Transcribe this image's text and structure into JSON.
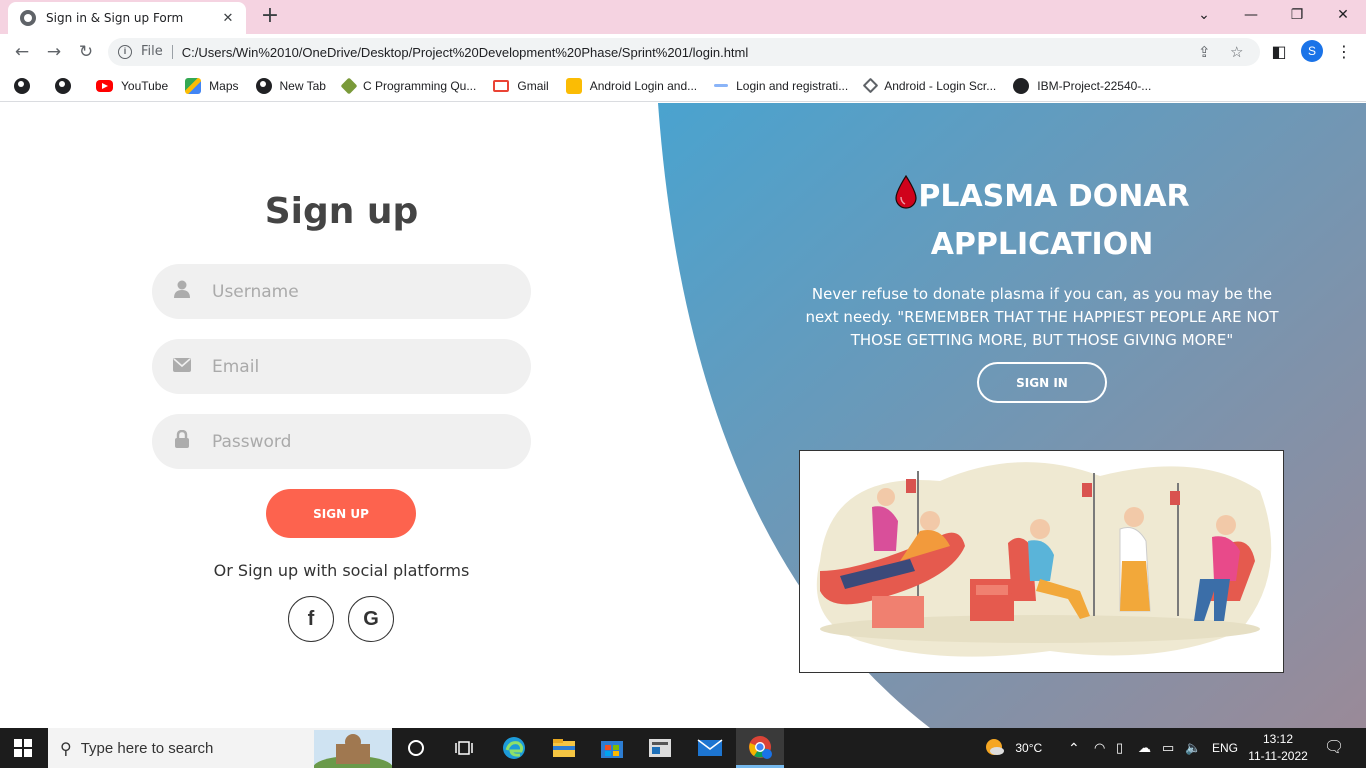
{
  "browser": {
    "tab_title": "Sign in & Sign up Form",
    "tab_close": "✕",
    "new_tab": "+",
    "scheme": "File",
    "url": "C:/Users/Win%2010/OneDrive/Desktop/Project%20Development%20Phase/Sprint%201/login.html",
    "profile_initial": "S",
    "bookmarks": [
      {
        "label": ""
      },
      {
        "label": ""
      },
      {
        "label": "YouTube"
      },
      {
        "label": "Maps"
      },
      {
        "label": "New Tab"
      },
      {
        "label": "C Programming Qu..."
      },
      {
        "label": "Gmail"
      },
      {
        "label": "Android Login and..."
      },
      {
        "label": "Login and registrati..."
      },
      {
        "label": "Android - Login Scr..."
      },
      {
        "label": "IBM-Project-22540-..."
      }
    ]
  },
  "signup": {
    "title": "Sign up",
    "username_placeholder": "Username",
    "email_placeholder": "Email",
    "password_placeholder": "Password",
    "button_label": "SIGN UP",
    "social_text": "Or Sign up with social platforms",
    "facebook_label": "f",
    "google_label": "G"
  },
  "panel": {
    "heading_line1": "PLASMA DONAR",
    "heading_line2": "APPLICATION",
    "description": "Never refuse to donate plasma if you can, as you may be the next needy. \"REMEMBER THAT THE HAPPIEST PEOPLE ARE NOT THOSE GETTING MORE, BUT THOSE GIVING MORE\"",
    "signin_label": "SIGN IN",
    "gradient_start": "#4aa3cf",
    "gradient_end": "#9a8a98",
    "drop_color": "#d0021b"
  },
  "taskbar": {
    "search_placeholder": "Type here to search",
    "weather": "30°C",
    "language": "ENG",
    "time": "13:12",
    "date": "11-11-2022"
  }
}
